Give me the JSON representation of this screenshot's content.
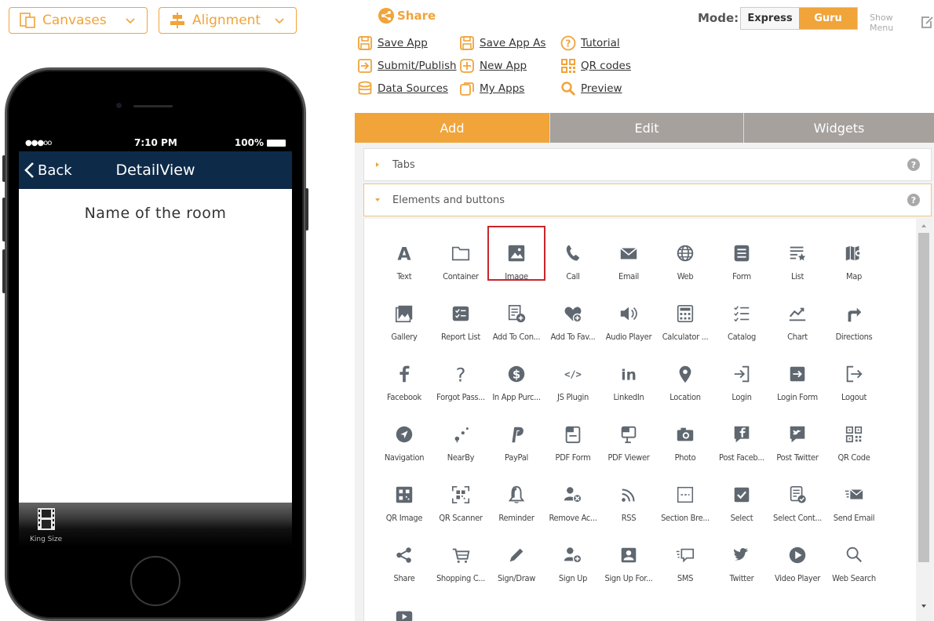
{
  "toolbar_left": {
    "canvases_label": "Canvases",
    "alignment_label": "Alignment"
  },
  "phone": {
    "signal": "●●●oo",
    "time": "7:10 PM",
    "battery": "100%",
    "back_label": "Back",
    "nav_title": "DetailView",
    "room_name": "Name of the room",
    "tab_label": "King Size"
  },
  "share_label": "Share",
  "menu": {
    "save_app": "Save App",
    "save_app_as": "Save App As",
    "tutorial": "Tutorial",
    "submit_publish": "Submit/Publish",
    "new_app": "New App",
    "qr_codes": "QR codes",
    "data_sources": "Data Sources",
    "my_apps": "My Apps",
    "preview": "Preview"
  },
  "mode": {
    "label": "Mode:",
    "express": "Express",
    "guru": "Guru",
    "show_menu": "Show Menu"
  },
  "panel_tabs": [
    "Add",
    "Edit",
    "Widgets"
  ],
  "accordion": {
    "tabs": "Tabs",
    "elements": "Elements and buttons",
    "help": "?"
  },
  "accent_color": "#f0a43a",
  "elements": [
    {
      "label": "Text",
      "icon": "text-icon"
    },
    {
      "label": "Container",
      "icon": "folder-icon"
    },
    {
      "label": "Image",
      "icon": "image-icon",
      "selected": true
    },
    {
      "label": "Call",
      "icon": "phone-icon"
    },
    {
      "label": "Email",
      "icon": "envelope-icon"
    },
    {
      "label": "Web",
      "icon": "globe-icon"
    },
    {
      "label": "Form",
      "icon": "form-icon"
    },
    {
      "label": "List",
      "icon": "list-star-icon"
    },
    {
      "label": "Map",
      "icon": "map-icon"
    },
    {
      "label": "Gallery",
      "icon": "gallery-icon"
    },
    {
      "label": "Report List",
      "icon": "report-list-icon"
    },
    {
      "label": "Add To Con...",
      "icon": "add-contact-icon"
    },
    {
      "label": "Add To Fav...",
      "icon": "heart-plus-icon"
    },
    {
      "label": "Audio Player",
      "icon": "speaker-icon"
    },
    {
      "label": "Calculator ...",
      "icon": "calculator-icon"
    },
    {
      "label": "Catalog",
      "icon": "catalog-icon"
    },
    {
      "label": "Chart",
      "icon": "chart-icon"
    },
    {
      "label": "Directions",
      "icon": "directions-icon"
    },
    {
      "label": "Facebook",
      "icon": "facebook-icon"
    },
    {
      "label": "Forgot Pass...",
      "icon": "question-icon"
    },
    {
      "label": "In App Purc...",
      "icon": "dollar-icon"
    },
    {
      "label": "JS Plugin",
      "icon": "code-icon"
    },
    {
      "label": "LinkedIn",
      "icon": "linkedin-icon"
    },
    {
      "label": "Location",
      "icon": "location-pin-icon"
    },
    {
      "label": "Login",
      "icon": "login-icon"
    },
    {
      "label": "Login Form",
      "icon": "login-form-icon"
    },
    {
      "label": "Logout",
      "icon": "logout-icon"
    },
    {
      "label": "Navigation",
      "icon": "navigation-icon"
    },
    {
      "label": "NearBy",
      "icon": "nearby-icon"
    },
    {
      "label": "PayPal",
      "icon": "paypal-icon"
    },
    {
      "label": "PDF Form",
      "icon": "pdf-form-icon"
    },
    {
      "label": "PDF Viewer",
      "icon": "pdf-viewer-icon"
    },
    {
      "label": "Photo",
      "icon": "camera-icon"
    },
    {
      "label": "Post Faceb...",
      "icon": "post-facebook-icon"
    },
    {
      "label": "Post Twitter",
      "icon": "post-twitter-icon"
    },
    {
      "label": "QR Code",
      "icon": "qr-code-icon"
    },
    {
      "label": "QR Image",
      "icon": "qr-image-icon"
    },
    {
      "label": "QR Scanner",
      "icon": "qr-scanner-icon"
    },
    {
      "label": "Reminder",
      "icon": "bell-icon"
    },
    {
      "label": "Remove Ac...",
      "icon": "remove-account-icon"
    },
    {
      "label": "RSS",
      "icon": "rss-icon"
    },
    {
      "label": "Section Bre...",
      "icon": "section-break-icon"
    },
    {
      "label": "Select",
      "icon": "checkbox-icon"
    },
    {
      "label": "Select Cont...",
      "icon": "select-contact-icon"
    },
    {
      "label": "Send Email",
      "icon": "send-email-icon"
    },
    {
      "label": "Share",
      "icon": "share-icon"
    },
    {
      "label": "Shopping C...",
      "icon": "cart-icon"
    },
    {
      "label": "Sign/Draw",
      "icon": "pencil-icon"
    },
    {
      "label": "Sign Up",
      "icon": "signup-icon"
    },
    {
      "label": "Sign Up For...",
      "icon": "signup-form-icon"
    },
    {
      "label": "SMS",
      "icon": "sms-icon"
    },
    {
      "label": "Twitter",
      "icon": "twitter-icon"
    },
    {
      "label": "Video Player",
      "icon": "play-icon"
    },
    {
      "label": "Web Search",
      "icon": "search-icon"
    },
    {
      "label": "",
      "icon": "video-icon"
    }
  ]
}
